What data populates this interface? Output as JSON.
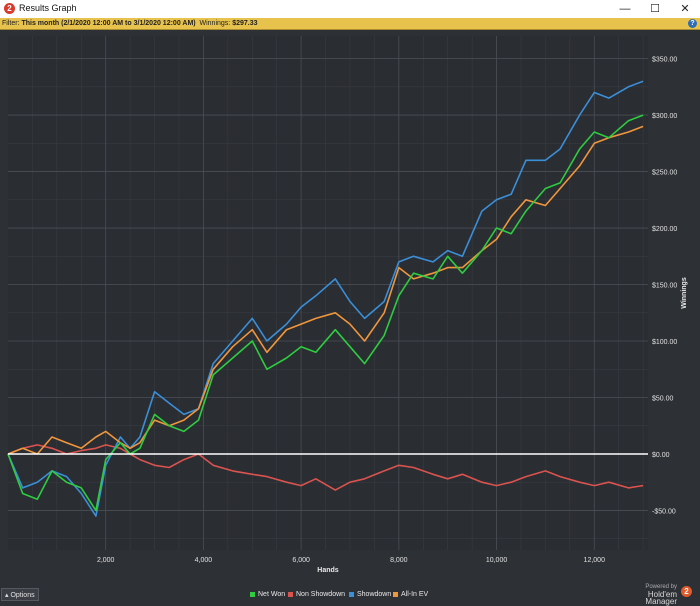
{
  "window": {
    "title": "Results Graph",
    "app_icon_glyph": "2",
    "minimize_glyph": "—",
    "maximize_glyph": "☐",
    "close_glyph": "✕"
  },
  "filter_bar": {
    "label": "Filter: ",
    "range": "This month (2/1/2020 12:00 AM to 3/1/2020 12:00 AM)",
    "winnings_label": "  Winnings: ",
    "winnings_value": "$297.33",
    "help_glyph": "?"
  },
  "options_button": {
    "label": "Options",
    "icon": "options-icon"
  },
  "branding": {
    "powered_by": "Powered by",
    "name": "Hold'em Manager",
    "logo_glyph": "2"
  },
  "chart_data": {
    "type": "line",
    "xlabel": "Hands",
    "ylabel": "Winnings",
    "xlim": [
      0,
      13100
    ],
    "ylim": [
      -85,
      370
    ],
    "x_ticks": [
      2000,
      4000,
      6000,
      8000,
      10000,
      12000
    ],
    "x_tick_labels": [
      "2,000",
      "4,000",
      "6,000",
      "8,000",
      "10,000",
      "12,000"
    ],
    "y_ticks": [
      -50,
      0,
      50,
      100,
      150,
      200,
      250,
      300,
      350
    ],
    "y_tick_labels": [
      "-$50.00",
      "$0.00",
      "$50.00",
      "$100.00",
      "$150.00",
      "$200.00",
      "$250.00",
      "$300.00",
      "$350.00"
    ],
    "grid": true,
    "legend_position": "bottom-center",
    "zero_line_color": "#ffffff",
    "series": [
      {
        "name": "Net Won",
        "color": "#2ecc40",
        "x": [
          0,
          300,
          600,
          900,
          1200,
          1500,
          1800,
          2000,
          2300,
          2500,
          2700,
          3000,
          3300,
          3600,
          3900,
          4200,
          4600,
          5000,
          5300,
          5700,
          6000,
          6300,
          6700,
          7000,
          7300,
          7700,
          8000,
          8300,
          8700,
          9000,
          9300,
          9700,
          10000,
          10300,
          10600,
          11000,
          11300,
          11700,
          12000,
          12300,
          12700,
          13000
        ],
        "values": [
          0,
          -35,
          -40,
          -15,
          -25,
          -30,
          -50,
          -5,
          10,
          0,
          5,
          35,
          25,
          20,
          30,
          70,
          85,
          100,
          75,
          85,
          95,
          90,
          110,
          95,
          80,
          105,
          140,
          160,
          155,
          175,
          160,
          180,
          200,
          195,
          215,
          235,
          240,
          270,
          285,
          280,
          295,
          300
        ]
      },
      {
        "name": "Non Showdown",
        "color": "#d9534f",
        "x": [
          0,
          300,
          600,
          900,
          1200,
          1500,
          1800,
          2000,
          2300,
          2500,
          2700,
          3000,
          3300,
          3600,
          3900,
          4200,
          4600,
          5000,
          5300,
          5700,
          6000,
          6300,
          6700,
          7000,
          7300,
          7700,
          8000,
          8300,
          8700,
          9000,
          9300,
          9700,
          10000,
          10300,
          10600,
          11000,
          11300,
          11700,
          12000,
          12300,
          12700,
          13000
        ],
        "values": [
          0,
          5,
          8,
          5,
          0,
          3,
          5,
          8,
          5,
          0,
          -5,
          -10,
          -12,
          -5,
          0,
          -10,
          -15,
          -18,
          -20,
          -25,
          -28,
          -22,
          -32,
          -25,
          -22,
          -15,
          -10,
          -12,
          -18,
          -22,
          -18,
          -25,
          -28,
          -25,
          -20,
          -15,
          -20,
          -25,
          -28,
          -25,
          -30,
          -28
        ]
      },
      {
        "name": "Showdown",
        "color": "#3b8fd9",
        "x": [
          0,
          300,
          600,
          900,
          1200,
          1500,
          1800,
          2000,
          2300,
          2500,
          2700,
          3000,
          3300,
          3600,
          3900,
          4200,
          4600,
          5000,
          5300,
          5700,
          6000,
          6300,
          6700,
          7000,
          7300,
          7700,
          8000,
          8300,
          8700,
          9000,
          9300,
          9700,
          10000,
          10300,
          10600,
          11000,
          11300,
          11700,
          12000,
          12300,
          12700,
          13000
        ],
        "values": [
          0,
          -30,
          -25,
          -15,
          -20,
          -35,
          -55,
          -10,
          15,
          5,
          15,
          55,
          45,
          35,
          40,
          80,
          100,
          120,
          100,
          115,
          130,
          140,
          155,
          135,
          120,
          135,
          170,
          175,
          170,
          180,
          175,
          215,
          225,
          230,
          260,
          260,
          270,
          300,
          320,
          315,
          325,
          330
        ]
      },
      {
        "name": "All-In EV",
        "color": "#f0963c",
        "x": [
          0,
          300,
          600,
          900,
          1200,
          1500,
          1800,
          2000,
          2300,
          2500,
          2700,
          3000,
          3300,
          3600,
          3900,
          4200,
          4600,
          5000,
          5300,
          5700,
          6000,
          6300,
          6700,
          7000,
          7300,
          7700,
          8000,
          8300,
          8700,
          9000,
          9300,
          9700,
          10000,
          10300,
          10600,
          11000,
          11300,
          11700,
          12000,
          12300,
          12700,
          13000
        ],
        "values": [
          0,
          5,
          0,
          15,
          10,
          5,
          15,
          20,
          10,
          5,
          10,
          30,
          25,
          30,
          40,
          75,
          95,
          110,
          90,
          110,
          115,
          120,
          125,
          115,
          100,
          125,
          165,
          155,
          160,
          165,
          165,
          180,
          190,
          210,
          225,
          220,
          235,
          255,
          275,
          280,
          285,
          290
        ]
      }
    ]
  }
}
